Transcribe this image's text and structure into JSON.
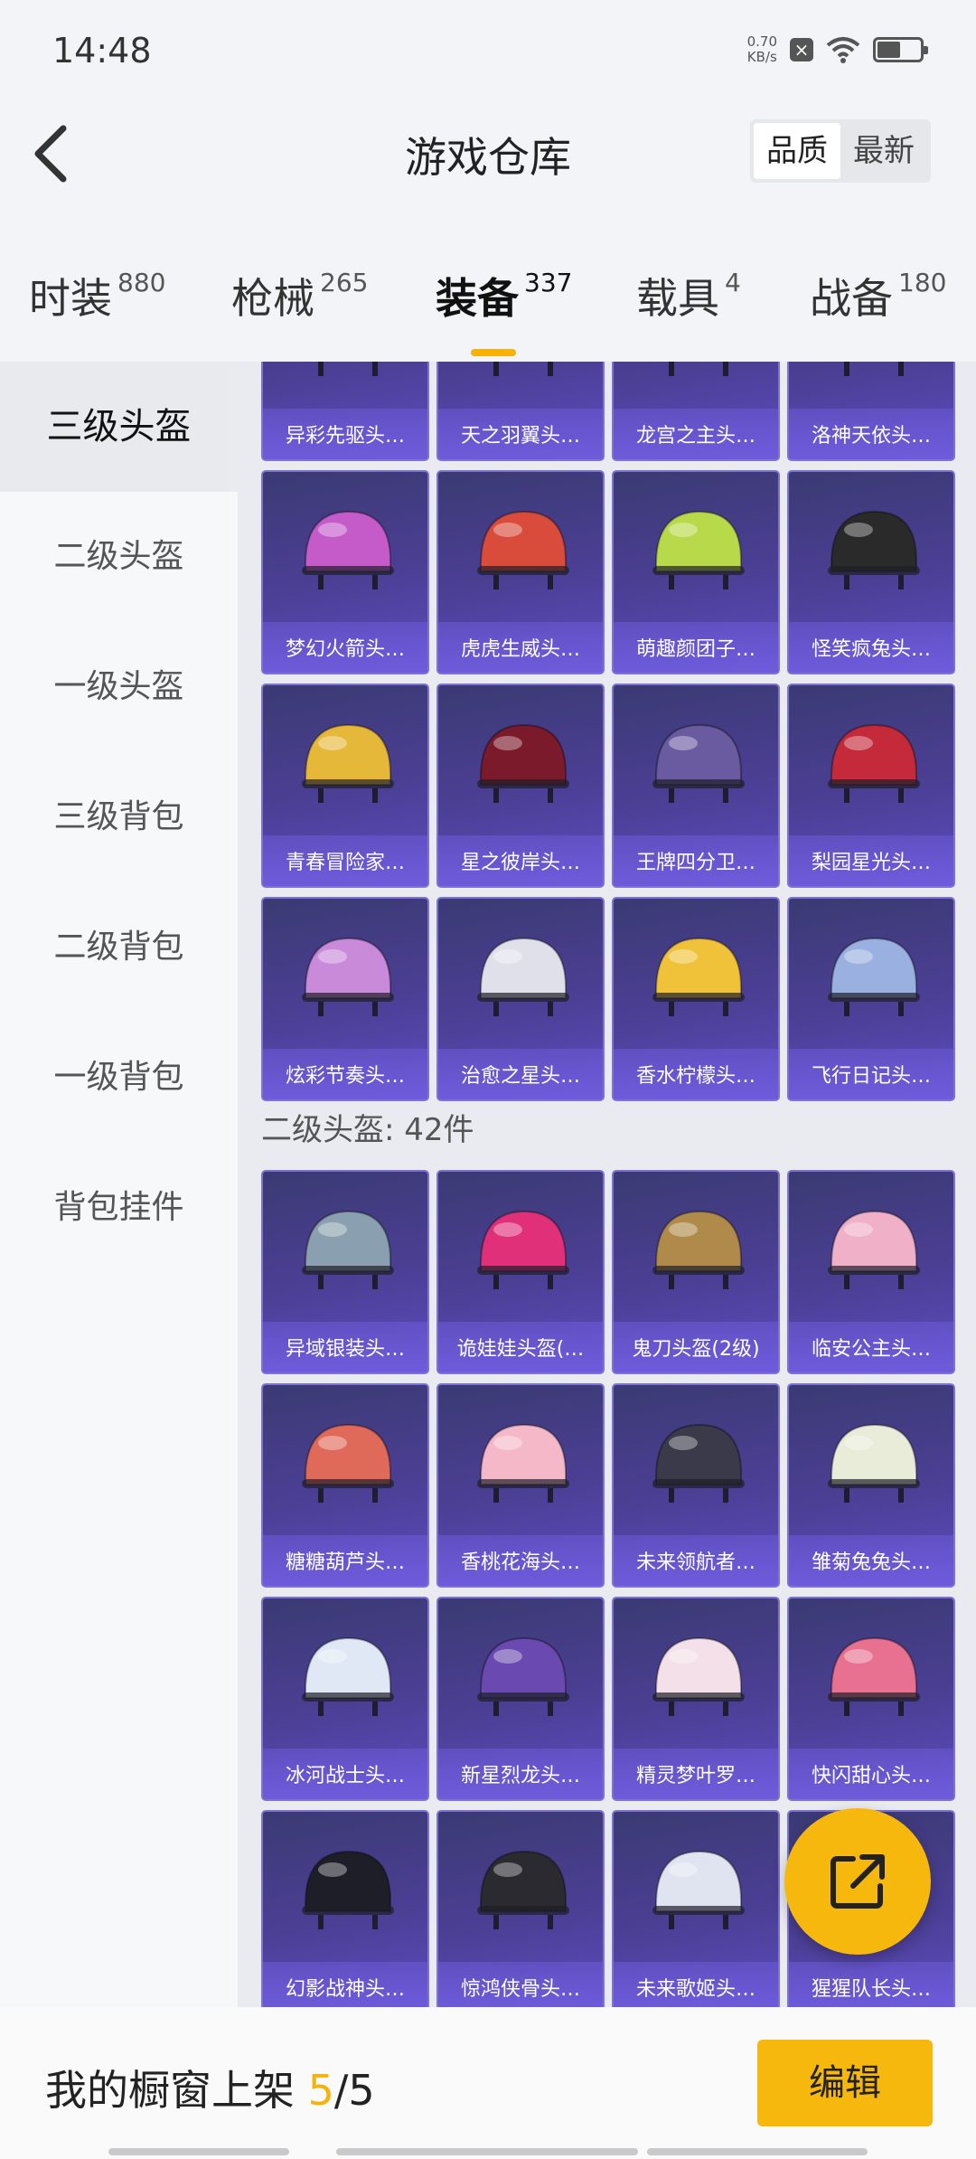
{
  "status": {
    "time": "14:48",
    "net_speed_value": "0.70",
    "net_speed_unit": "KB/s"
  },
  "header": {
    "title": "游戏仓库",
    "sort_options": [
      "品质",
      "最新"
    ],
    "sort_selected": "品质"
  },
  "tabs": [
    {
      "label": "时装",
      "count": "880"
    },
    {
      "label": "枪械",
      "count": "265"
    },
    {
      "label": "装备",
      "count": "337"
    },
    {
      "label": "载具",
      "count": "4"
    },
    {
      "label": "战备",
      "count": "180"
    }
  ],
  "active_tab": "装备",
  "sidebar": [
    {
      "label": "三级头盔"
    },
    {
      "label": "二级头盔"
    },
    {
      "label": "一级头盔"
    },
    {
      "label": "三级背包"
    },
    {
      "label": "二级背包"
    },
    {
      "label": "一级背包"
    },
    {
      "label": "背包挂件"
    }
  ],
  "sidebar_active": "三级头盔",
  "level3_items": [
    {
      "name": "异彩先驱头…",
      "color": "#3a3a4a"
    },
    {
      "name": "天之羽翼头…",
      "color": "#6a8a6a"
    },
    {
      "name": "龙宫之主头…",
      "color": "#8ab0c0"
    },
    {
      "name": "洛神天依头…",
      "color": "#c9d4e0"
    },
    {
      "name": "梦幻火箭头…",
      "color": "#c45bc9"
    },
    {
      "name": "虎虎生威头…",
      "color": "#d94b3a"
    },
    {
      "name": "萌趣颜团子…",
      "color": "#b7d94a"
    },
    {
      "name": "怪笑疯兔头…",
      "color": "#2a2a2a"
    },
    {
      "name": "青春冒险家…",
      "color": "#e6b83a"
    },
    {
      "name": "星之彼岸头…",
      "color": "#7a1a2a"
    },
    {
      "name": "王牌四分卫…",
      "color": "#6a5aa0"
    },
    {
      "name": "梨园星光头…",
      "color": "#c42a3a"
    },
    {
      "name": "炫彩节奏头…",
      "color": "#c98ad9"
    },
    {
      "name": "治愈之星头…",
      "color": "#e0e0ea"
    },
    {
      "name": "香水柠檬头…",
      "color": "#f0c23a"
    },
    {
      "name": "飞行日记头…",
      "color": "#9ab0e0"
    }
  ],
  "level2_section": {
    "title": "二级头盔: 42件"
  },
  "level2_items": [
    {
      "name": "异域银装头…",
      "color": "#8aa0b0"
    },
    {
      "name": "诡娃娃头盔(…",
      "color": "#e0307a"
    },
    {
      "name": "鬼刀头盔(2级)",
      "color": "#b08a4a"
    },
    {
      "name": "临安公主头…",
      "color": "#f0b0c8"
    },
    {
      "name": "糖糖葫芦头…",
      "color": "#e06a5a"
    },
    {
      "name": "香桃花海头…",
      "color": "#f4b8c8"
    },
    {
      "name": "未来领航者…",
      "color": "#3a3a4a"
    },
    {
      "name": "雏菊兔兔头…",
      "color": "#e8ecd8"
    },
    {
      "name": "冰河战士头…",
      "color": "#dfe8f4"
    },
    {
      "name": "新星烈龙头…",
      "color": "#6a4ab0"
    },
    {
      "name": "精灵梦叶罗…",
      "color": "#f4e0e8"
    },
    {
      "name": "快闪甜心头…",
      "color": "#e87090"
    },
    {
      "name": "幻影战神头…",
      "color": "#1e1e28"
    },
    {
      "name": "惊鸿侠骨头…",
      "color": "#2a2a30"
    },
    {
      "name": "未来歌姬头…",
      "color": "#dfe4f0"
    },
    {
      "name": "猩猩队长头…",
      "color": "#a04a3a"
    }
  ],
  "footer": {
    "label": "我的橱窗上架",
    "count_current": "5",
    "count_separator": "/",
    "count_total": "5",
    "edit_label": "编辑"
  },
  "colors": {
    "accent": "#f7b80d",
    "card": "#4c3f96"
  }
}
